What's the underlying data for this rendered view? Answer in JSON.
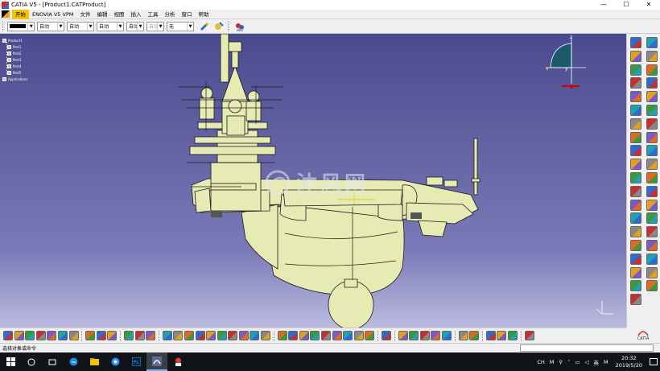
{
  "window": {
    "title": "CATIA V5 - [Product1.CATProduct]",
    "controls": [
      "—",
      "☐",
      "✕"
    ]
  },
  "menubar": {
    "items": [
      "开始",
      "ENOVIA V5 VPM",
      "文件",
      "编辑",
      "视图",
      "插入",
      "工具",
      "分析",
      "窗口",
      "帮助"
    ],
    "active_index": 0
  },
  "propbar": {
    "color_combo": "",
    "line_type_combo": "自动",
    "line_weight_combo": "自动",
    "point_combo": "自动",
    "layer_combo": "自动",
    "layer_disabled_combo": "自动",
    "filter_combo": "无"
  },
  "tree": {
    "nodes": [
      "Product1",
      "Part1",
      "Part2",
      "Part3",
      "Part4",
      "Part5",
      "Applications"
    ]
  },
  "watermark": {
    "text": "沐风网",
    "sub": "MFCAD.COM"
  },
  "compass": {
    "axis_x": "x",
    "axis_y": "y",
    "axis_z": "z"
  },
  "status": {
    "message": "选择对象或命令"
  },
  "taskbar": {
    "apps": [
      "search",
      "task-view",
      "edge",
      "explorer",
      "chrome",
      "photoshop",
      "catia",
      "app"
    ],
    "tray": [
      "CH",
      "M",
      "英",
      "M"
    ],
    "time": "20:32",
    "date": "2019/5/20"
  },
  "catia_logo": "CATIA",
  "colors": {
    "viewport_top": "#4a4a8e",
    "viewport_bottom": "#c8c8e8",
    "model_fill": "#e6ebb4",
    "model_stroke": "#1a1a1a",
    "menu_active": "#f5c400",
    "taskbar": "#101418"
  }
}
